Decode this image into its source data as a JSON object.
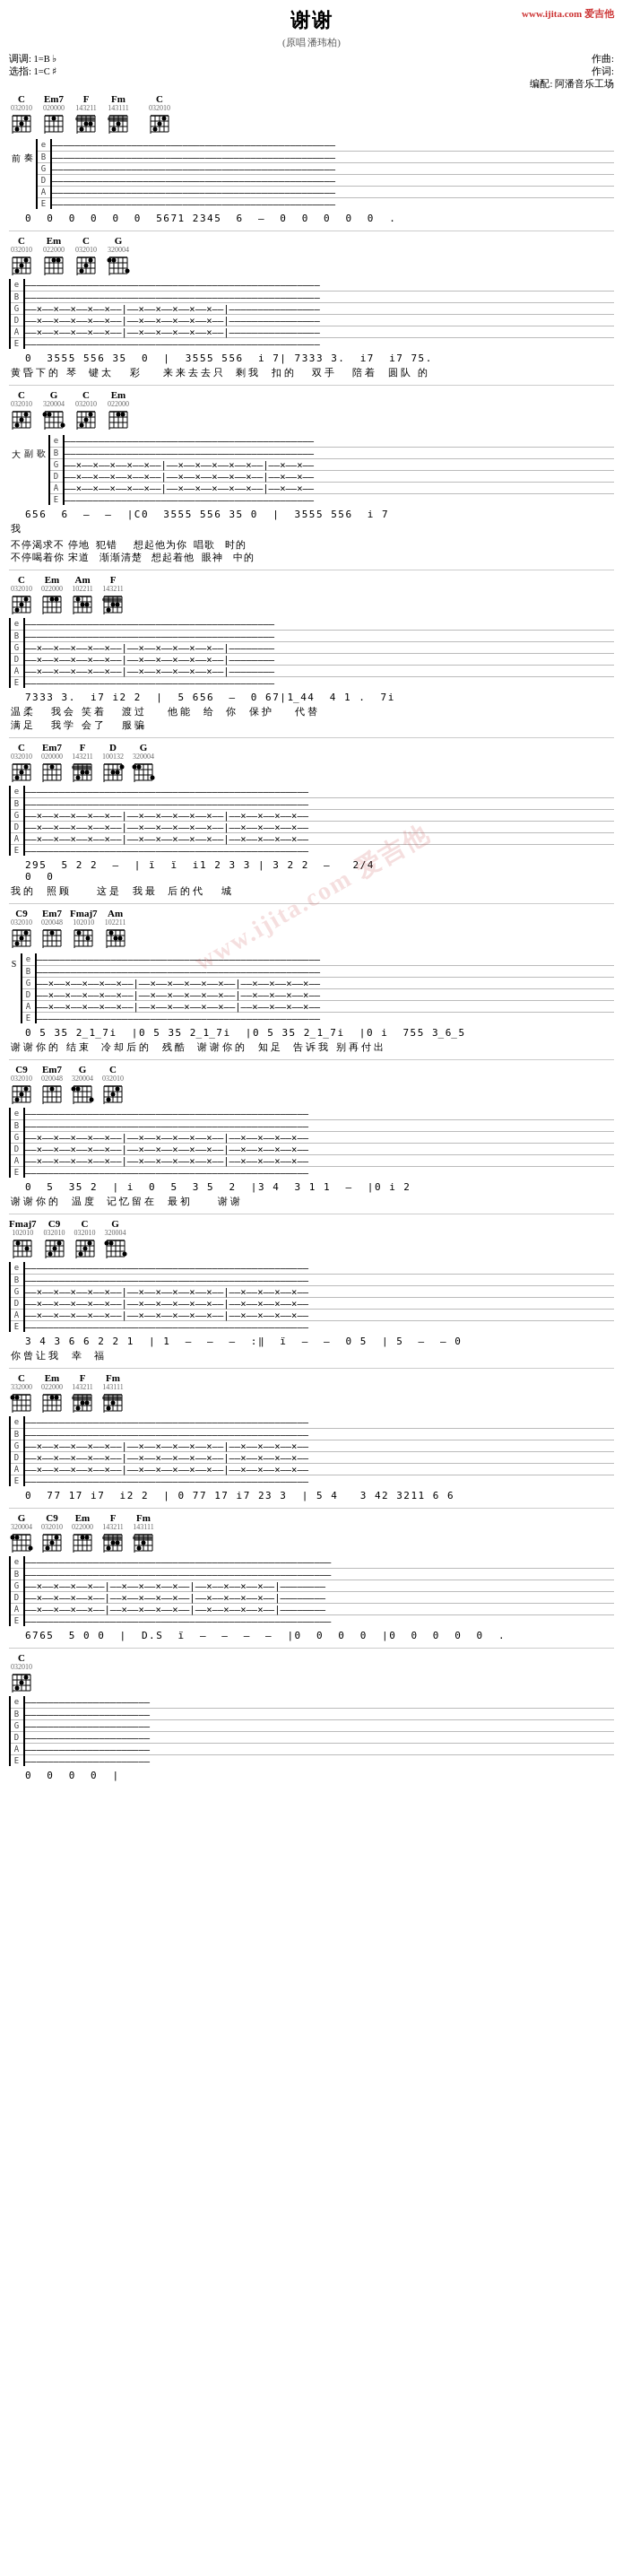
{
  "header": {
    "title": "谢谢",
    "subtitle": "(原唱 潘玮柏)",
    "site": "www.ijita.com 爱吉他",
    "tempo": "调调: 1=B ♭",
    "tuning": "选指: 1=C ♯",
    "composer": "作曲:",
    "lyricist": "作词:",
    "arranger": "编配: 阿潘音乐工场"
  },
  "sections": []
}
